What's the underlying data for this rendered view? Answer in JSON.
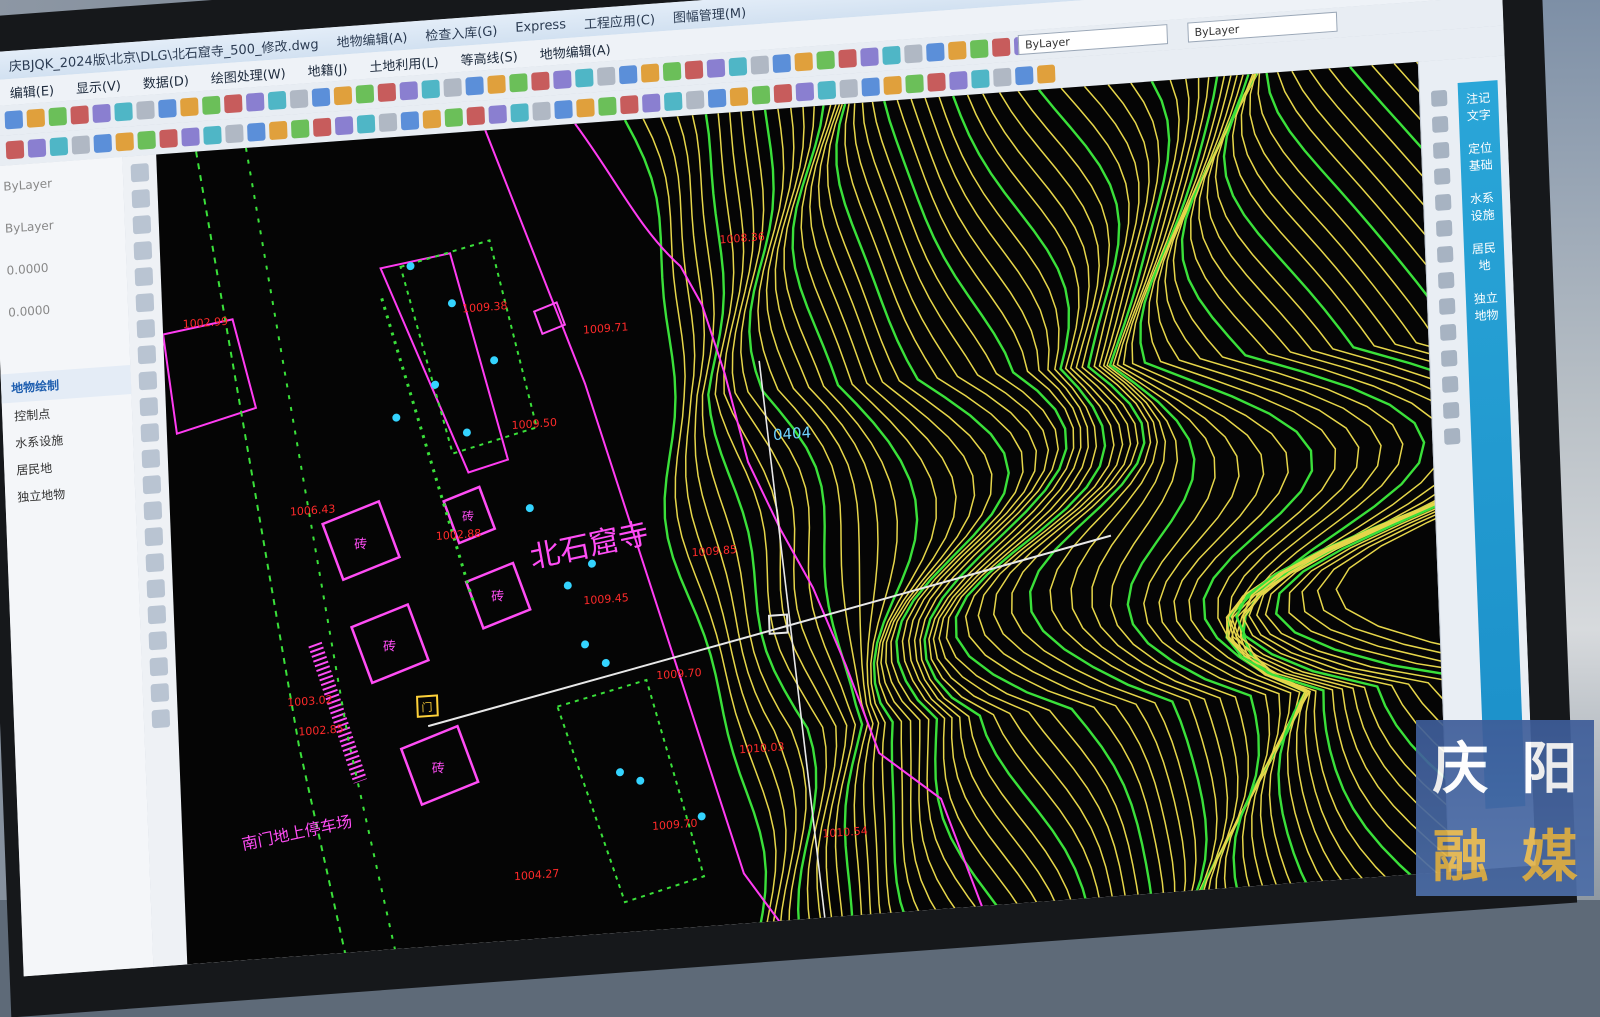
{
  "window": {
    "title_segments": [
      "庆BJQK_2024版\\北京\\DLG\\北石窟寺_500_修改.dwg",
      "地物编辑(A)",
      "检查入库(G)",
      "Express",
      "工程应用(C)",
      "图幅管理(M)"
    ],
    "layer_selector": "ByLayer",
    "linetype_selector": "ByLayer"
  },
  "menubar": [
    "编辑(E)",
    "显示(V)",
    "数据(D)",
    "绘图处理(W)",
    "地籍(J)",
    "土地利用(L)",
    "等高线(S)",
    "地物编辑(A)"
  ],
  "left_panel": {
    "properties": [
      "ByLayer",
      "ByLayer",
      "0.0000",
      "0.0000"
    ],
    "section_title": "地物绘制",
    "items": [
      "控制点",
      "水系设施",
      "居民地",
      "独立地物"
    ]
  },
  "right_panel": {
    "tabs": [
      "注记文字",
      "定位基础",
      "水系设施",
      "居民地",
      "独立地物"
    ]
  },
  "map": {
    "site_label": "北石窟寺",
    "parking_label": "南门地上停车场",
    "grid_label": "0404",
    "building_labels": [
      "砖",
      "砖",
      "砖",
      "砖",
      "砖",
      "门"
    ],
    "elevations": [
      "1009.38",
      "1009.71",
      "1009.50",
      "1009.85",
      "1009.45",
      "1009.70",
      "1009.70",
      "1010.03",
      "1004.27",
      "1003.02",
      "1002.99",
      "1002.85",
      "1002.88",
      "1006.43",
      "1008.36",
      "1010.54"
    ],
    "colors": {
      "background": "#050505",
      "contour_major": "#e6d64a",
      "contour_index": "#3ae03a",
      "boundary": "#ff3cf2",
      "label": "#ff2a2a",
      "building": "#ff4df5",
      "points": "#34d4ff"
    }
  },
  "watermark": {
    "chars": [
      "庆",
      "阳",
      "融",
      "媒"
    ]
  }
}
